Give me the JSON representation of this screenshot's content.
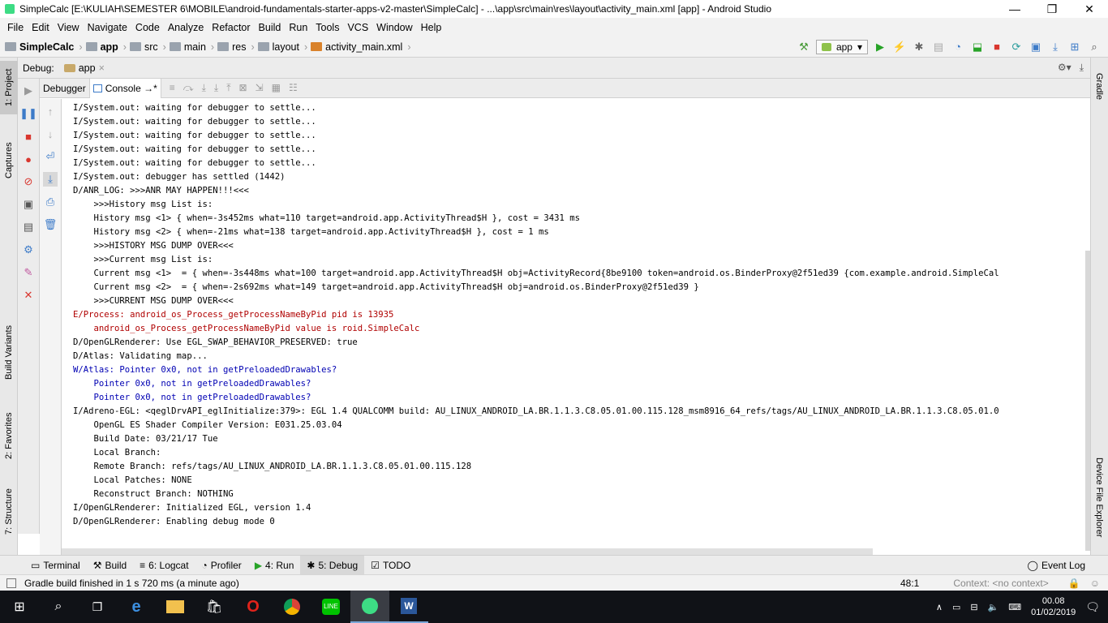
{
  "window": {
    "title": "SimpleCalc [E:\\KULIAH\\SEMESTER 6\\MOBILE\\android-fundamentals-starter-apps-v2-master\\SimpleCalc] - ...\\app\\src\\main\\res\\layout\\activity_main.xml [app] - Android Studio",
    "minimize": "—",
    "maximize": "❐",
    "close": "✕"
  },
  "menu": [
    "File",
    "Edit",
    "View",
    "Navigate",
    "Code",
    "Analyze",
    "Refactor",
    "Build",
    "Run",
    "Tools",
    "VCS",
    "Window",
    "Help"
  ],
  "breadcrumb": [
    "SimpleCalc",
    "app",
    "src",
    "main",
    "res",
    "layout",
    "activity_main.xml"
  ],
  "run_config": "app",
  "left_tabs": [
    "1: Project",
    "Captures",
    "Build Variants",
    "2: Favorites",
    "7: Structure"
  ],
  "right_tabs": [
    "Gradle",
    "Device File Explorer"
  ],
  "debug": {
    "label": "Debug:",
    "session": "app",
    "tab_debugger": "Debugger",
    "tab_console": "Console →*"
  },
  "console_lines": [
    {
      "t": "I/System.out: waiting for debugger to settle...",
      "k": "info"
    },
    {
      "t": "I/System.out: waiting for debugger to settle...",
      "k": "info"
    },
    {
      "t": "I/System.out: waiting for debugger to settle...",
      "k": "info"
    },
    {
      "t": "I/System.out: waiting for debugger to settle...",
      "k": "info"
    },
    {
      "t": "I/System.out: waiting for debugger to settle...",
      "k": "info"
    },
    {
      "t": "I/System.out: debugger has settled (1442)",
      "k": "info"
    },
    {
      "t": "D/ANR_LOG: >>>ANR MAY HAPPEN!!!<<<",
      "k": "info"
    },
    {
      "t": "    >>>History msg List is:",
      "k": "info"
    },
    {
      "t": "    History msg <1> { when=-3s452ms what=110 target=android.app.ActivityThread$H }, cost = 3431 ms",
      "k": "info"
    },
    {
      "t": "    History msg <2> { when=-21ms what=138 target=android.app.ActivityThread$H }, cost = 1 ms",
      "k": "info"
    },
    {
      "t": "    >>>HISTORY MSG DUMP OVER<<<",
      "k": "info"
    },
    {
      "t": "    >>>Current msg List is:",
      "k": "info"
    },
    {
      "t": "    Current msg <1>  = { when=-3s448ms what=100 target=android.app.ActivityThread$H obj=ActivityRecord{8be9100 token=android.os.BinderProxy@2f51ed39 {com.example.android.SimpleCal",
      "k": "info"
    },
    {
      "t": "    Current msg <2>  = { when=-2s692ms what=149 target=android.app.ActivityThread$H obj=android.os.BinderProxy@2f51ed39 }",
      "k": "info"
    },
    {
      "t": "    >>>CURRENT MSG DUMP OVER<<<",
      "k": "info"
    },
    {
      "t": "E/Process: android_os_Process_getProcessNameByPid pid is 13935",
      "k": "err"
    },
    {
      "t": "    android_os_Process_getProcessNameByPid value is roid.SimpleCalc",
      "k": "err"
    },
    {
      "t": "D/OpenGLRenderer: Use EGL_SWAP_BEHAVIOR_PRESERVED: true",
      "k": "info"
    },
    {
      "t": "D/Atlas: Validating map...",
      "k": "info"
    },
    {
      "t": "W/Atlas: Pointer 0x0, not in getPreloadedDrawables?",
      "k": "warn"
    },
    {
      "t": "    Pointer 0x0, not in getPreloadedDrawables?",
      "k": "warn"
    },
    {
      "t": "    Pointer 0x0, not in getPreloadedDrawables?",
      "k": "warn"
    },
    {
      "t": "I/Adreno-EGL: <qeglDrvAPI_eglInitialize:379>: EGL 1.4 QUALCOMM build: AU_LINUX_ANDROID_LA.BR.1.1.3.C8.05.01.00.115.128_msm8916_64_refs/tags/AU_LINUX_ANDROID_LA.BR.1.1.3.C8.05.01.0",
      "k": "info"
    },
    {
      "t": "    OpenGL ES Shader Compiler Version: E031.25.03.04",
      "k": "info"
    },
    {
      "t": "    Build Date: 03/21/17 Tue",
      "k": "info"
    },
    {
      "t": "    Local Branch:",
      "k": "info"
    },
    {
      "t": "    Remote Branch: refs/tags/AU_LINUX_ANDROID_LA.BR.1.1.3.C8.05.01.00.115.128",
      "k": "info"
    },
    {
      "t": "    Local Patches: NONE",
      "k": "info"
    },
    {
      "t": "    Reconstruct Branch: NOTHING",
      "k": "info"
    },
    {
      "t": "I/OpenGLRenderer: Initialized EGL, version 1.4",
      "k": "info"
    },
    {
      "t": "D/OpenGLRenderer: Enabling debug mode 0",
      "k": "info"
    }
  ],
  "bottom_tabs": [
    {
      "label": "Terminal",
      "icon": "terminal-icon"
    },
    {
      "label": "Build",
      "icon": "build-icon"
    },
    {
      "label": "6: Logcat",
      "icon": "logcat-icon"
    },
    {
      "label": "Profiler",
      "icon": "profiler-icon"
    },
    {
      "label": "4: Run",
      "icon": "run-icon"
    },
    {
      "label": "5: Debug",
      "icon": "debug-icon"
    },
    {
      "label": "TODO",
      "icon": "todo-icon"
    }
  ],
  "event_log": "Event Log",
  "status": {
    "message": "Gradle build finished in 1 s 720 ms (a minute ago)",
    "position": "48:1",
    "context": "Context: <no context>"
  },
  "taskbar": {
    "time": "00.08",
    "date": "01/02/2019"
  },
  "colors": {
    "error": "#b00000",
    "warning": "#0000b3",
    "run_green": "#27a327"
  }
}
